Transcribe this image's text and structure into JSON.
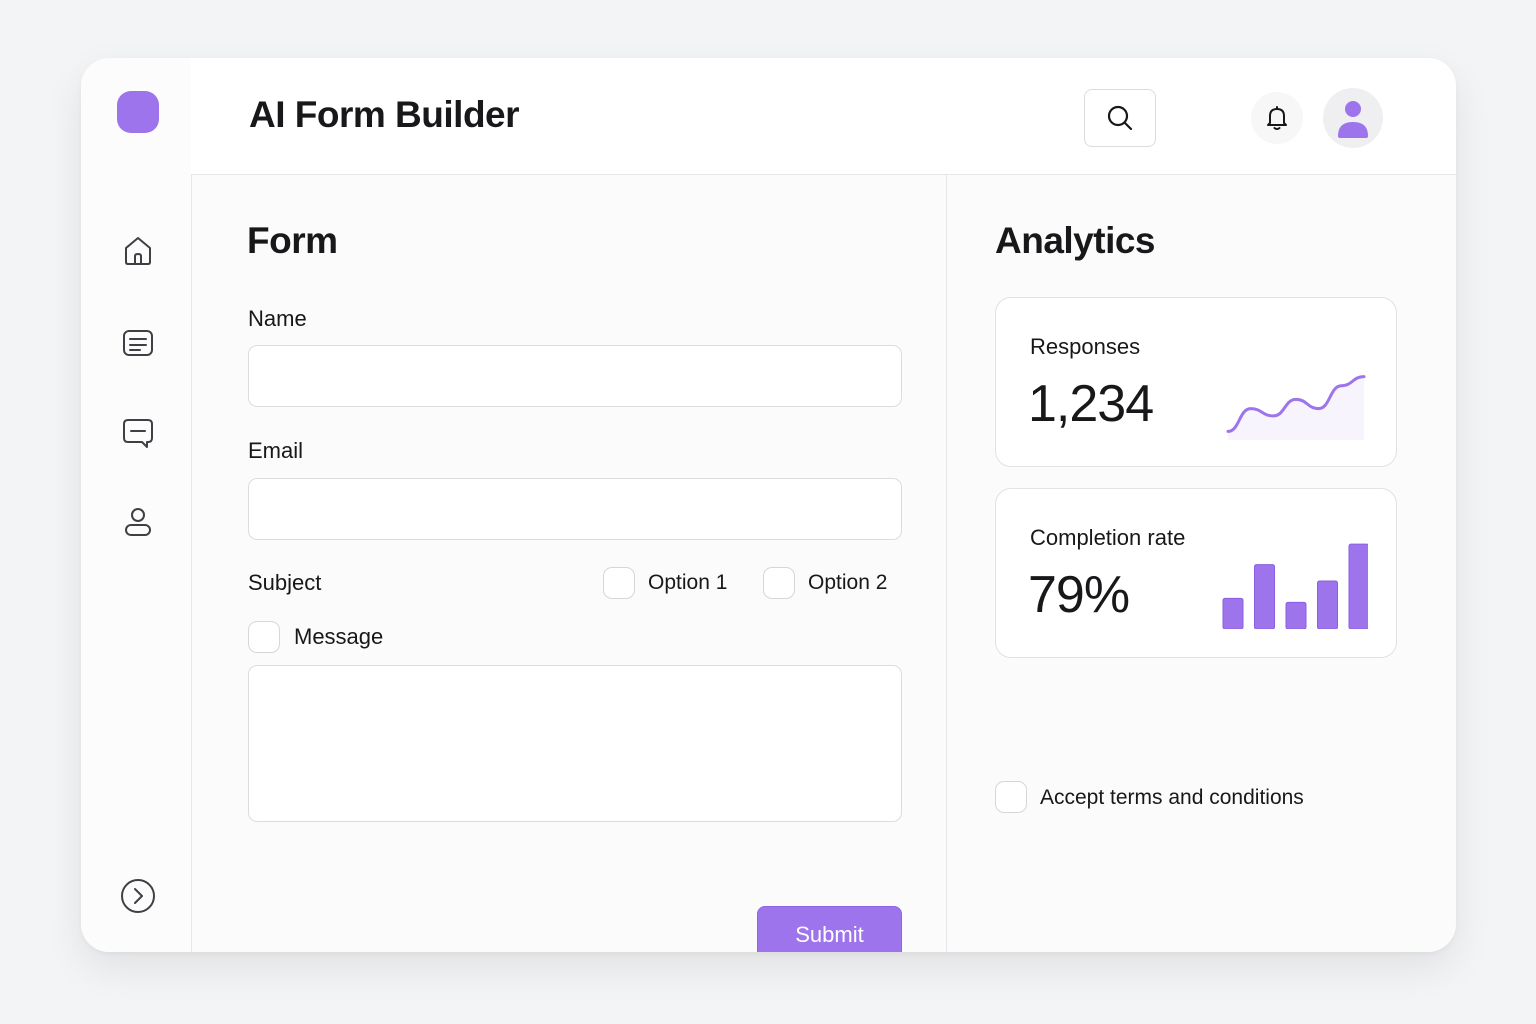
{
  "app": {
    "title": "AI Form Builder"
  },
  "sidebar": {
    "items": [
      {
        "icon": "home-icon"
      },
      {
        "icon": "forms-list-icon"
      },
      {
        "icon": "messages-icon"
      },
      {
        "icon": "user-icon"
      }
    ],
    "footer_icon": "expand-arrow-icon"
  },
  "form": {
    "title": "Form",
    "name_label": "Name",
    "name_value": "",
    "email_label": "Email",
    "email_value": "",
    "subject_label": "Subject",
    "option1_label": "Option 1",
    "option2_label": "Option 2",
    "message_label": "Message",
    "message_value": "",
    "submit_label": "Submit"
  },
  "analytics": {
    "title": "Analytics",
    "responses": {
      "label": "Responses",
      "value": "1,234"
    },
    "completion": {
      "label": "Completion rate",
      "value": "79%"
    },
    "terms_label": "Accept terms and conditions"
  },
  "colors": {
    "accent": "#9d74ec",
    "text": "#18181b",
    "border": "#dcdce0"
  },
  "chart_data": [
    {
      "type": "line",
      "x": [
        1,
        2,
        3,
        4,
        5,
        6,
        7
      ],
      "values": [
        5,
        30,
        22,
        40,
        30,
        55,
        65
      ],
      "ylim": [
        0,
        70
      ],
      "grid": false
    },
    {
      "type": "bar",
      "categories": [
        "1",
        "2",
        "3",
        "4",
        "5"
      ],
      "values": [
        30,
        63,
        26,
        47,
        83
      ],
      "ylim": [
        0,
        90
      ],
      "grid": false
    }
  ]
}
